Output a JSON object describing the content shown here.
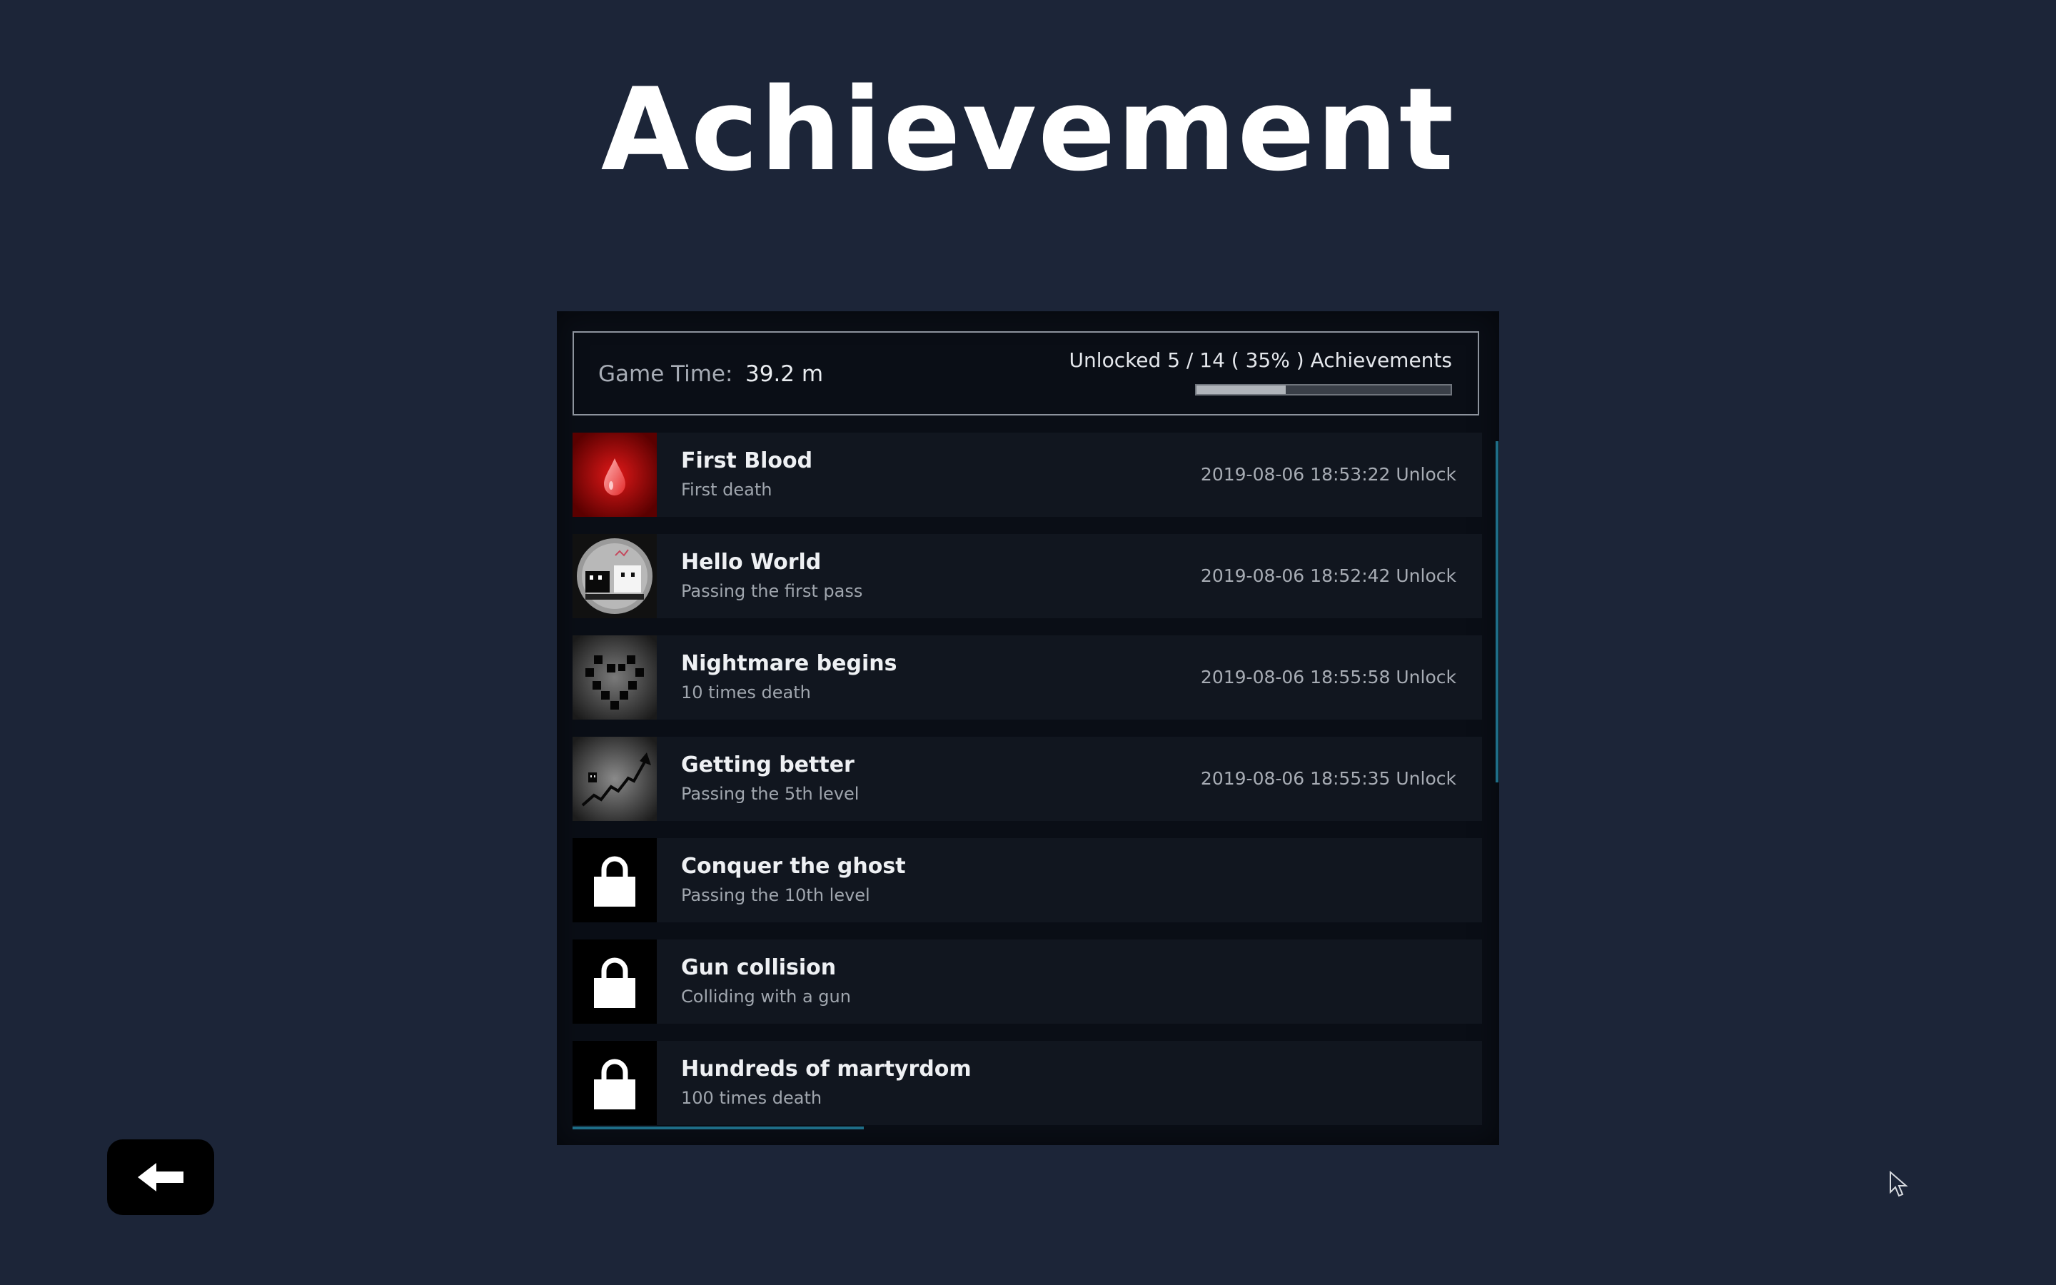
{
  "title": "Achievement",
  "stats": {
    "game_time_label": "Game Time:",
    "game_time_value": "39.2 m",
    "unlocked_text": "Unlocked 5 / 14 ( 35% ) Achievements",
    "unlocked_count": 5,
    "total_count": 14,
    "progress_fraction": 0.35
  },
  "achievements": [
    {
      "title": "First Blood",
      "description": "First death",
      "time": "2019-08-06 18:53:22 Unlock",
      "icon": "blood-drop-icon",
      "unlocked": true
    },
    {
      "title": "Hello World",
      "description": "Passing the first pass",
      "time": "2019-08-06 18:52:42 Unlock",
      "icon": "hello-world-icon",
      "unlocked": true
    },
    {
      "title": "Nightmare begins",
      "description": "10 times death",
      "time": "2019-08-06 18:55:58 Unlock",
      "icon": "pixel-heart-icon",
      "unlocked": true
    },
    {
      "title": "Getting better",
      "description": "Passing the 5th level",
      "time": "2019-08-06 18:55:35 Unlock",
      "icon": "rising-arrow-icon",
      "unlocked": true
    },
    {
      "title": "Conquer the ghost",
      "description": "Passing the 10th level",
      "time": "",
      "icon": "lock-icon",
      "unlocked": false
    },
    {
      "title": "Gun collision",
      "description": "Colliding with a gun",
      "time": "",
      "icon": "lock-icon",
      "unlocked": false
    },
    {
      "title": "Hundreds of martyrdom",
      "description": "100 times death",
      "time": "",
      "icon": "lock-icon",
      "unlocked": false
    }
  ],
  "back_button": {
    "icon": "back-arrow-icon"
  },
  "colors": {
    "background": "#1c2538",
    "panel": "#0a0e16",
    "row": "#11161f",
    "scroll_accent": "#1e6d87"
  }
}
